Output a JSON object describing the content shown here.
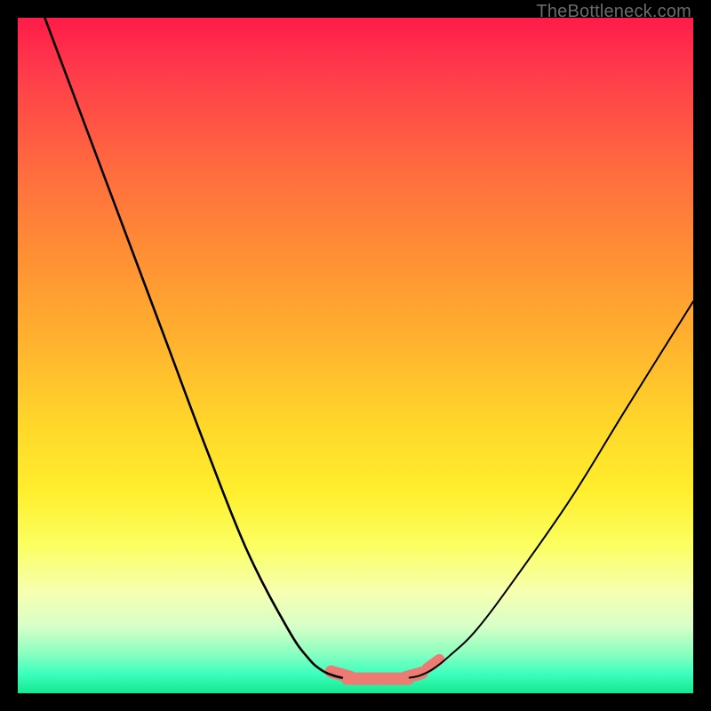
{
  "watermark": "TheBottleneck.com",
  "chart_data": {
    "type": "line",
    "title": "",
    "xlabel": "",
    "ylabel": "",
    "xlim": [
      0,
      100
    ],
    "ylim": [
      0,
      100
    ],
    "grid": false,
    "legend": false,
    "series": [
      {
        "name": "left-branch",
        "x": [
          4,
          10,
          16,
          22,
          28,
          34,
          40,
          43,
          45,
          46.8,
          48
        ],
        "values": [
          100,
          84,
          68,
          52,
          36,
          21,
          9.5,
          5.2,
          3.4,
          2.6,
          2.3
        ]
      },
      {
        "name": "right-branch",
        "x": [
          58,
          59.5,
          61.5,
          64,
          68,
          74,
          82,
          90,
          100
        ],
        "values": [
          2.3,
          2.6,
          3.6,
          5.6,
          9.5,
          17.5,
          29,
          42,
          58
        ]
      }
    ],
    "highlight_segments": [
      {
        "x": [
          46.4,
          49.2
        ],
        "y": [
          3.2,
          2.4
        ],
        "width": 14
      },
      {
        "x": [
          48.8,
          57.8
        ],
        "y": [
          2.15,
          2.15
        ],
        "width": 14
      },
      {
        "x": [
          57.4,
          59.8
        ],
        "y": [
          2.35,
          3.0
        ],
        "width": 14
      },
      {
        "x": [
          60.6,
          62.4
        ],
        "y": [
          3.7,
          5.0
        ],
        "width": 12
      }
    ],
    "colors": {
      "curve": "#000000",
      "highlight": "#ed7b73"
    }
  }
}
